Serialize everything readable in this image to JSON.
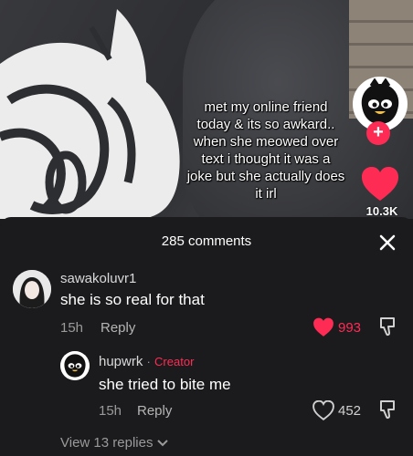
{
  "video": {
    "caption_lines": [
      "met my online friend",
      "today & its so awkard..",
      "when she meowed over",
      "text i thought it was a",
      "joke but she actually does",
      "it irl"
    ],
    "like_count": "10.3K",
    "follow_symbol": "+"
  },
  "comments_sheet": {
    "title": "285 comments",
    "comments": [
      {
        "username": "sawakoluvr1",
        "text": "she is so real for that",
        "time": "15h",
        "reply_label": "Reply",
        "likes": "993",
        "liked": true
      }
    ],
    "replies": [
      {
        "username": "hupwrk",
        "separator": "·",
        "badge": "Creator",
        "text": "she tried to bite me",
        "time": "15h",
        "reply_label": "Reply",
        "likes": "452",
        "liked": false
      }
    ],
    "view_replies_label": "View 13 replies"
  },
  "colors": {
    "accent": "#fe2c55",
    "sheet_bg": "#1b1b1d"
  }
}
